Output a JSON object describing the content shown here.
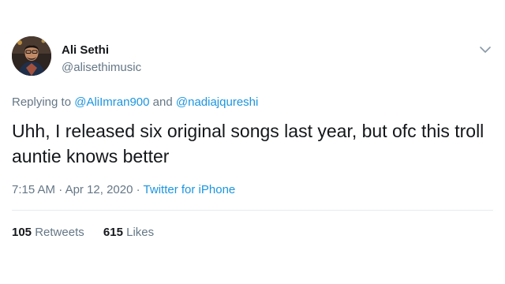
{
  "author": {
    "name": "Ali Sethi",
    "handle": "@alisethimusic"
  },
  "reply": {
    "prefix": "Replying to ",
    "mention_1": "@AliImran900",
    "joiner": " and ",
    "mention_2": "@nadiajqureshi"
  },
  "tweet": {
    "text": "Uhh, I released six original songs last year, but ofc this troll auntie knows better"
  },
  "meta": {
    "time": "7:15 AM",
    "date": "Apr 12, 2020",
    "separator": " · ",
    "source": "Twitter for iPhone"
  },
  "stats": {
    "retweets_count": "105",
    "retweets_label": "Retweets",
    "likes_count": "615",
    "likes_label": "Likes"
  },
  "icons": {
    "menu": "chevron-down-icon"
  },
  "colors": {
    "primary_text": "#14171a",
    "secondary_text": "#657786",
    "link": "#1b95e0",
    "divider": "#e6ecf0"
  }
}
